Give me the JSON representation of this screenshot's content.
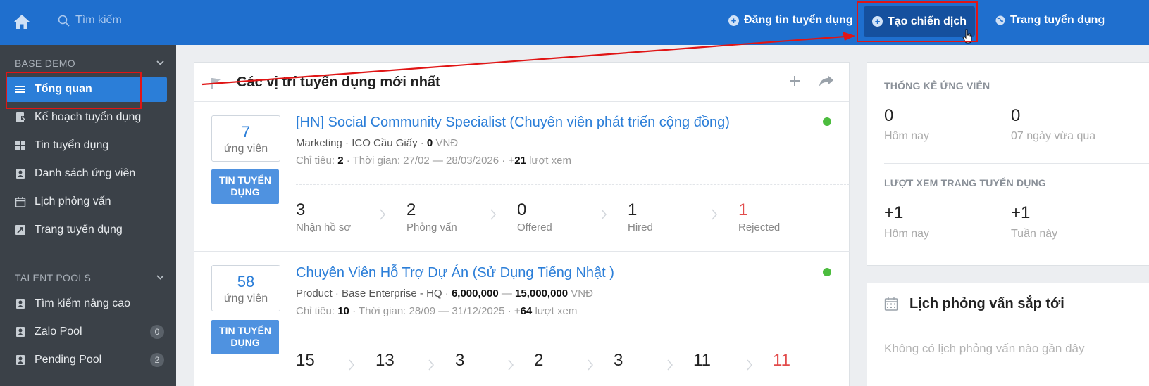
{
  "topbar": {
    "search_placeholder": "Tìm kiếm",
    "post_job_label": "Đăng tin tuyển dụng",
    "create_campaign_label": "Tạo chiến dịch",
    "career_page_label": "Trang tuyển dụng",
    "bg_color": "#1f6fce"
  },
  "sidebar": {
    "section1": "BASE DEMO",
    "items": [
      {
        "label": "Tổng quan",
        "icon": "menu-icon",
        "active": true
      },
      {
        "label": "Kế hoạch tuyển dụng",
        "icon": "plan-icon"
      },
      {
        "label": "Tin tuyển dụng",
        "icon": "grid-icon"
      },
      {
        "label": "Danh sách ứng viên",
        "icon": "candidate-icon"
      },
      {
        "label": "Lịch phỏng vấn",
        "icon": "calendar-icon"
      },
      {
        "label": "Trang tuyển dụng",
        "icon": "page-icon"
      }
    ],
    "section2": "TALENT POOLS",
    "pools": [
      {
        "label": "Tìm kiếm nâng cao",
        "badge": null
      },
      {
        "label": "Zalo Pool",
        "badge": "0"
      },
      {
        "label": "Pending Pool",
        "badge": "2"
      }
    ]
  },
  "main": {
    "title": "Các vị trí tuyển dụng mới nhất",
    "jobs": [
      {
        "count": "7",
        "count_label": "ứng viên",
        "tag": "TIN TUYỂN DỤNG",
        "title": "[HN] Social Community Specialist (Chuyên viên phát triển cộng đồng)",
        "dept": "Marketing",
        "office": "ICO Cầu Giấy",
        "salary": "0",
        "currency": "VNĐ",
        "quota_label": "Chỉ tiêu:",
        "quota": "2",
        "time_label": "Thời gian:",
        "time": "27/02 — 28/03/2026",
        "views_prefix": "+",
        "views": "21",
        "views_label": "lượt xem",
        "stages": [
          {
            "num": "3",
            "label": "Nhận hồ sơ"
          },
          {
            "num": "2",
            "label": "Phỏng vấn"
          },
          {
            "num": "0",
            "label": "Offered"
          },
          {
            "num": "1",
            "label": "Hired"
          },
          {
            "num": "1",
            "label": "Rejected"
          }
        ]
      },
      {
        "count": "58",
        "count_label": "ứng viên",
        "tag": "TIN TUYỂN DỤNG",
        "title": "Chuyên Viên Hỗ Trợ Dự Án (Sử Dụng Tiếng Nhật )",
        "dept": "Product",
        "office": "Base Enterprise - HQ",
        "salary_min": "6,000,000",
        "salary_max": "15,000,000",
        "currency": "VNĐ",
        "quota_label": "Chỉ tiêu:",
        "quota": "10",
        "time_label": "Thời gian:",
        "time": "28/09 — 31/12/2025",
        "views_prefix": "+",
        "views": "64",
        "views_label": "lượt xem",
        "stages": [
          {
            "num": "15"
          },
          {
            "num": "13"
          },
          {
            "num": "3"
          },
          {
            "num": "2"
          },
          {
            "num": "3"
          },
          {
            "num": "11"
          },
          {
            "num": "11"
          }
        ]
      }
    ]
  },
  "stats": {
    "heading1": "THỐNG KÊ ỨNG VIÊN",
    "today_count": "0",
    "today_label": "Hôm nay",
    "week_count": "0",
    "week_label": "07 ngày vừa qua",
    "heading2": "LƯỢT XEM TRANG TUYỂN DỤNG",
    "views_today": "+1",
    "views_today_label": "Hôm nay",
    "views_week": "+1",
    "views_week_label": "Tuần này"
  },
  "interviews": {
    "title": "Lịch phỏng vấn sắp tới",
    "empty": "Không có lịch phỏng vấn nào gần đây"
  }
}
